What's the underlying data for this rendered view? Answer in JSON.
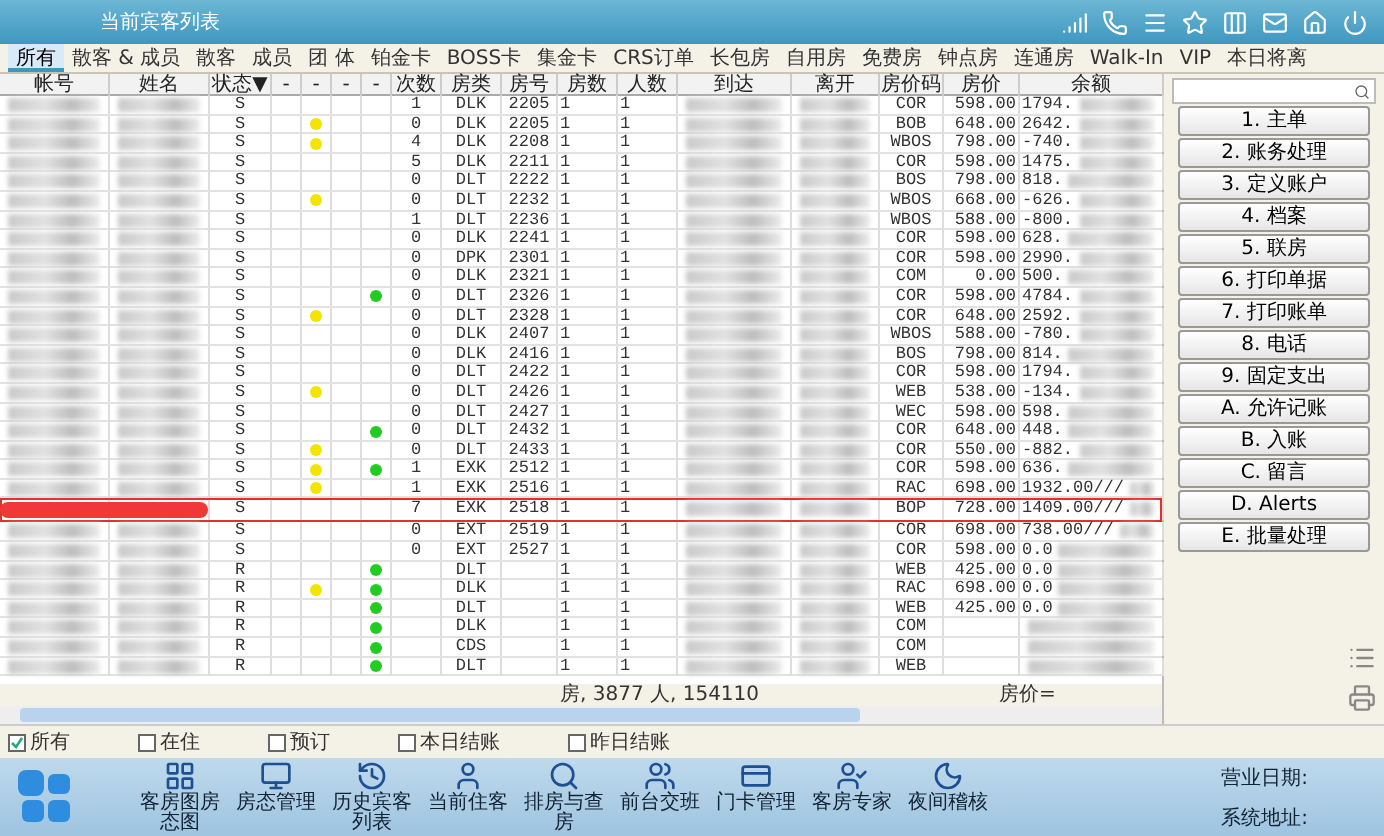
{
  "window": {
    "title": "当前宾客列表"
  },
  "tabs": [
    {
      "label": "所有",
      "selected": true
    },
    {
      "label": "散客 & 成员",
      "selected": false
    },
    {
      "label": "散客",
      "selected": false
    },
    {
      "label": "成员",
      "selected": false
    },
    {
      "label": "团 体",
      "selected": false
    },
    {
      "label": "铂金卡",
      "selected": false
    },
    {
      "label": "BOSS卡",
      "selected": false
    },
    {
      "label": "集金卡",
      "selected": false
    },
    {
      "label": "CRS订单",
      "selected": false
    },
    {
      "label": "长包房",
      "selected": false
    },
    {
      "label": "自用房",
      "selected": false
    },
    {
      "label": "免费房",
      "selected": false
    },
    {
      "label": "钟点房",
      "selected": false
    },
    {
      "label": "连通房",
      "selected": false
    },
    {
      "label": "Walk-In",
      "selected": false
    },
    {
      "label": "VIP",
      "selected": false
    },
    {
      "label": "本日将离",
      "selected": false
    }
  ],
  "table": {
    "columns": [
      "帐号",
      "姓名",
      "状态▼",
      "-",
      "-",
      "-",
      "-",
      "次数",
      "房类",
      "房号",
      "房数",
      "人数",
      "到达",
      "离开",
      "房价码",
      "房价",
      "余额"
    ],
    "rows": [
      {
        "status": "S",
        "dot_1": false,
        "dot_2": false,
        "count": "1",
        "room_type": "DLK",
        "room": "2205",
        "rooms": "1",
        "guests": "1",
        "rate_code": "COR",
        "rate": "598.00",
        "balance": "1794.",
        "selected": false
      },
      {
        "status": "S",
        "dot_1": true,
        "dot_2": false,
        "count": "0",
        "room_type": "DLK",
        "room": "2205",
        "rooms": "1",
        "guests": "1",
        "rate_code": "BOB",
        "rate": "648.00",
        "balance": "2642.",
        "selected": false
      },
      {
        "status": "S",
        "dot_1": true,
        "dot_2": false,
        "count": "4",
        "room_type": "DLK",
        "room": "2208",
        "rooms": "1",
        "guests": "1",
        "rate_code": "WBOS",
        "rate": "798.00",
        "balance": "-740.",
        "selected": false
      },
      {
        "status": "S",
        "dot_1": false,
        "dot_2": false,
        "count": "5",
        "room_type": "DLK",
        "room": "2211",
        "rooms": "1",
        "guests": "1",
        "rate_code": "COR",
        "rate": "598.00",
        "balance": "1475.",
        "selected": false
      },
      {
        "status": "S",
        "dot_1": false,
        "dot_2": false,
        "count": "0",
        "room_type": "DLT",
        "room": "2222",
        "rooms": "1",
        "guests": "1",
        "rate_code": "BOS",
        "rate": "798.00",
        "balance": "818.",
        "selected": false
      },
      {
        "status": "S",
        "dot_1": true,
        "dot_2": false,
        "count": "0",
        "room_type": "DLT",
        "room": "2232",
        "rooms": "1",
        "guests": "1",
        "rate_code": "WBOS",
        "rate": "668.00",
        "balance": "-626.",
        "selected": false
      },
      {
        "status": "S",
        "dot_1": false,
        "dot_2": false,
        "count": "1",
        "room_type": "DLT",
        "room": "2236",
        "rooms": "1",
        "guests": "1",
        "rate_code": "WBOS",
        "rate": "588.00",
        "balance": "-800.",
        "selected": false
      },
      {
        "status": "S",
        "dot_1": false,
        "dot_2": false,
        "count": "0",
        "room_type": "DLK",
        "room": "2241",
        "rooms": "1",
        "guests": "1",
        "rate_code": "COR",
        "rate": "598.00",
        "balance": "628.",
        "selected": false
      },
      {
        "status": "S",
        "dot_1": false,
        "dot_2": false,
        "count": "0",
        "room_type": "DPK",
        "room": "2301",
        "rooms": "1",
        "guests": "1",
        "rate_code": "COR",
        "rate": "598.00",
        "balance": "2990.",
        "selected": false
      },
      {
        "status": "S",
        "dot_1": false,
        "dot_2": false,
        "count": "0",
        "room_type": "DLK",
        "room": "2321",
        "rooms": "1",
        "guests": "1",
        "rate_code": "COM",
        "rate": "0.00",
        "balance": "500.",
        "selected": false
      },
      {
        "status": "S",
        "dot_1": false,
        "dot_2": true,
        "count": "0",
        "room_type": "DLT",
        "room": "2326",
        "rooms": "1",
        "guests": "1",
        "rate_code": "COR",
        "rate": "598.00",
        "balance": "4784.",
        "selected": false
      },
      {
        "status": "S",
        "dot_1": true,
        "dot_2": false,
        "count": "0",
        "room_type": "DLT",
        "room": "2328",
        "rooms": "1",
        "guests": "1",
        "rate_code": "COR",
        "rate": "648.00",
        "balance": "2592.",
        "selected": false
      },
      {
        "status": "S",
        "dot_1": false,
        "dot_2": false,
        "count": "0",
        "room_type": "DLK",
        "room": "2407",
        "rooms": "1",
        "guests": "1",
        "rate_code": "WBOS",
        "rate": "588.00",
        "balance": "-780.",
        "selected": false
      },
      {
        "status": "S",
        "dot_1": false,
        "dot_2": false,
        "count": "0",
        "room_type": "DLK",
        "room": "2416",
        "rooms": "1",
        "guests": "1",
        "rate_code": "BOS",
        "rate": "798.00",
        "balance": "814.",
        "selected": false
      },
      {
        "status": "S",
        "dot_1": false,
        "dot_2": false,
        "count": "0",
        "room_type": "DLT",
        "room": "2422",
        "rooms": "1",
        "guests": "1",
        "rate_code": "COR",
        "rate": "598.00",
        "balance": "1794.",
        "selected": false
      },
      {
        "status": "S",
        "dot_1": true,
        "dot_2": false,
        "count": "0",
        "room_type": "DLT",
        "room": "2426",
        "rooms": "1",
        "guests": "1",
        "rate_code": "WEB",
        "rate": "538.00",
        "balance": "-134.",
        "selected": false
      },
      {
        "status": "S",
        "dot_1": false,
        "dot_2": false,
        "count": "0",
        "room_type": "DLT",
        "room": "2427",
        "rooms": "1",
        "guests": "1",
        "rate_code": "WEC",
        "rate": "598.00",
        "balance": "598.",
        "selected": false
      },
      {
        "status": "S",
        "dot_1": false,
        "dot_2": true,
        "count": "0",
        "room_type": "DLT",
        "room": "2432",
        "rooms": "1",
        "guests": "1",
        "rate_code": "COR",
        "rate": "648.00",
        "balance": "448.",
        "selected": false
      },
      {
        "status": "S",
        "dot_1": true,
        "dot_2": false,
        "count": "0",
        "room_type": "DLT",
        "room": "2433",
        "rooms": "1",
        "guests": "1",
        "rate_code": "COR",
        "rate": "550.00",
        "balance": "-882.",
        "selected": false
      },
      {
        "status": "S",
        "dot_1": true,
        "dot_2": true,
        "count": "1",
        "room_type": "EXK",
        "room": "2512",
        "rooms": "1",
        "guests": "1",
        "rate_code": "COR",
        "rate": "598.00",
        "balance": "636.",
        "selected": false
      },
      {
        "status": "S",
        "dot_1": true,
        "dot_2": false,
        "count": "1",
        "room_type": "EXK",
        "room": "2516",
        "rooms": "1",
        "guests": "1",
        "rate_code": "RAC",
        "rate": "698.00",
        "balance": "1932.00///",
        "selected": false
      },
      {
        "status": "S",
        "dot_1": false,
        "dot_2": false,
        "count": "7",
        "room_type": "EXK",
        "room": "2518",
        "rooms": "1",
        "guests": "1",
        "rate_code": "BOP",
        "rate": "728.00",
        "balance": "1409.00///",
        "selected": true
      },
      {
        "status": "S",
        "dot_1": false,
        "dot_2": false,
        "count": "0",
        "room_type": "EXT",
        "room": "2519",
        "rooms": "1",
        "guests": "1",
        "rate_code": "COR",
        "rate": "698.00",
        "balance": "738.00///",
        "selected": false
      },
      {
        "status": "S",
        "dot_1": false,
        "dot_2": false,
        "count": "0",
        "room_type": "EXT",
        "room": "2527",
        "rooms": "1",
        "guests": "1",
        "rate_code": "COR",
        "rate": "598.00",
        "balance": "0.0",
        "selected": false
      },
      {
        "status": "R",
        "dot_1": false,
        "dot_2": true,
        "room_type": "DLT",
        "rooms": "1",
        "guests": "1",
        "rate_code": "WEB",
        "rate": "425.00",
        "balance": "0.0",
        "selected": false
      },
      {
        "status": "R",
        "dot_1": true,
        "dot_2": true,
        "room_type": "DLK",
        "rooms": "1",
        "guests": "1",
        "rate_code": "RAC",
        "rate": "698.00",
        "balance": "0.0",
        "selected": false
      },
      {
        "status": "R",
        "dot_1": false,
        "dot_2": true,
        "room_type": "DLT",
        "rooms": "1",
        "guests": "1",
        "rate_code": "WEB",
        "rate": "425.00",
        "balance": "0.0",
        "selected": false
      },
      {
        "status": "R",
        "dot_1": false,
        "dot_2": true,
        "room_type": "DLK",
        "rooms": "1",
        "guests": "1",
        "rate_code": "COM",
        "selected": false
      },
      {
        "status": "R",
        "dot_1": false,
        "dot_2": true,
        "room_type": "CDS",
        "rooms": "1",
        "guests": "1",
        "rate_code": "COM",
        "selected": false
      },
      {
        "status": "R",
        "dot_1": false,
        "dot_2": true,
        "room_type": "DLT",
        "rooms": "1",
        "guests": "1",
        "rate_code": "WEB",
        "selected": false
      }
    ]
  },
  "summary": {
    "totals": "房, 3877 人, 154110",
    "rate": "房价="
  },
  "side_buttons": [
    "1. 主单",
    "2. 账务处理",
    "3. 定义账户",
    "4. 档案",
    "5. 联房",
    "6. 打印单据",
    "7. 打印账单",
    "8. 电话",
    "9. 固定支出",
    "A. 允许记账",
    "B. 入账",
    "C. 留言",
    "D. Alerts",
    "E. 批量处理"
  ],
  "filters": [
    {
      "label": "所有",
      "checked": true
    },
    {
      "label": "在住",
      "checked": false
    },
    {
      "label": "预订",
      "checked": false
    },
    {
      "label": "本日结账",
      "checked": false
    },
    {
      "label": "昨日结账",
      "checked": false
    }
  ],
  "toolbar": [
    {
      "kind": "grid",
      "label": "客房图房态图"
    },
    {
      "kind": "monitor",
      "label": "房态管理"
    },
    {
      "kind": "history",
      "label": "历史宾客列表"
    },
    {
      "kind": "person",
      "label": "当前住客"
    },
    {
      "kind": "search",
      "label": "排房与查房"
    },
    {
      "kind": "group",
      "label": "前台交班"
    },
    {
      "kind": "card",
      "label": "门卡管理"
    },
    {
      "kind": "expert",
      "label": "客房专家"
    },
    {
      "kind": "night",
      "label": "夜间稽核"
    }
  ],
  "info": [
    "营业日期:",
    "系统地址:"
  ]
}
